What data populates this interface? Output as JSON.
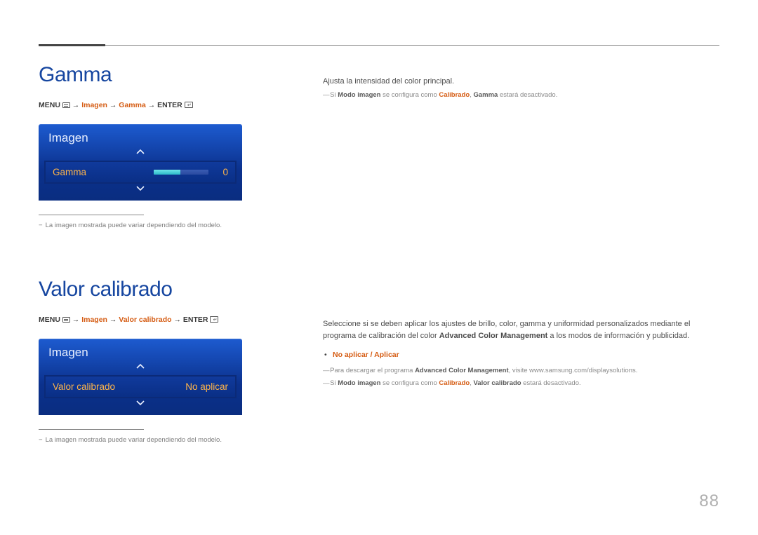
{
  "page_number": "88",
  "section1": {
    "title": "Gamma",
    "breadcrumb": {
      "menu": "MENU",
      "path1": "Imagen",
      "path2": "Gamma",
      "enter": "ENTER"
    },
    "card": {
      "header": "Imagen",
      "item_label": "Gamma",
      "item_value": "0"
    },
    "footnote": "La imagen mostrada puede variar dependiendo del modelo."
  },
  "section2": {
    "title": "Valor calibrado",
    "breadcrumb": {
      "menu": "MENU",
      "path1": "Imagen",
      "path2": "Valor calibrado",
      "enter": "ENTER"
    },
    "card": {
      "header": "Imagen",
      "item_label": "Valor calibrado",
      "item_value": "No aplicar"
    },
    "footnote": "La imagen mostrada puede variar dependiendo del modelo."
  },
  "right1": {
    "para": "Ajusta la intensidad del color principal.",
    "note_pre": "Si ",
    "note_b1": "Modo imagen",
    "note_mid": " se configura como ",
    "note_b2": "Calibrado",
    "note_mid2": ", ",
    "note_b3": "Gamma",
    "note_post": " estará desactivado."
  },
  "right2": {
    "para_a": "Seleccione si se deben aplicar los ajustes de brillo, color, gamma y uniformidad personalizados mediante el programa de calibración del color ",
    "para_b_bold": "Advanced Color Management",
    "para_c": " a los modos de información y publicidad.",
    "bullet": "No aplicar / Aplicar",
    "note1_pre": "Para descargar el programa ",
    "note1_b": "Advanced Color Management",
    "note1_post": ", visite www.samsung.com/displaysolutions.",
    "note2_pre": "Si ",
    "note2_b1": "Modo imagen",
    "note2_mid": " se configura como ",
    "note2_b2": "Calibrado",
    "note2_mid2": ", ",
    "note2_b3": "Valor calibrado",
    "note2_post": " estará desactivado."
  }
}
